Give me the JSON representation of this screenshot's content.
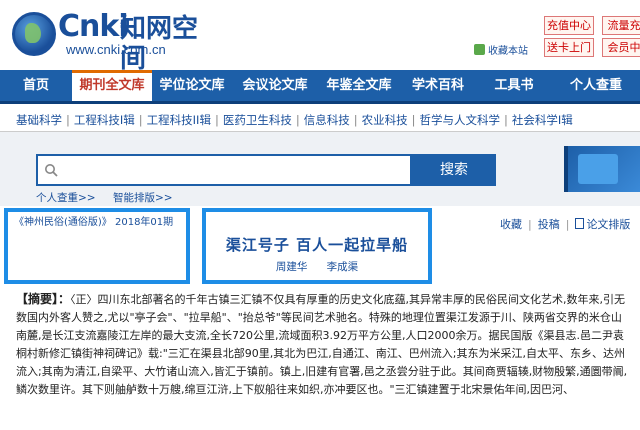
{
  "header": {
    "logo_brand": "Cnki",
    "logo_cn": "知网空间",
    "logo_url": "www.cnki.com.cn",
    "bookmark": "收藏本站",
    "buttons": [
      "充值中心",
      "流量充",
      "送卡上门",
      "会员中"
    ]
  },
  "nav": {
    "items": [
      "首页",
      "期刊全文库",
      "学位论文库",
      "会议论文库",
      "年鉴全文库",
      "学术百科",
      "工具书",
      "个人查重"
    ],
    "active_index": 1
  },
  "subnav": [
    "基础科学",
    "工程科技I辑",
    "工程科技II辑",
    "医药卫生科技",
    "信息科技",
    "农业科技",
    "哲学与人文科学",
    "社会科学I辑"
  ],
  "search": {
    "placeholder": "",
    "button": "搜索",
    "links": [
      "个人查重>>",
      "智能排版>>"
    ]
  },
  "article": {
    "source": "《神州民俗(通俗版)》 2018年01期",
    "title": "渠江号子 百人一起拉旱船",
    "authors": [
      "周建华",
      "李成渠"
    ],
    "actions": [
      "收藏",
      "投稿",
      "论文排版"
    ],
    "abstract_label": "【摘要】：",
    "abstract_text": "〈正〉四川东北部著名的千年古镇三汇镇不仅具有厚重的历史文化底蕴,其异常丰厚的民俗民间文化艺术,数年来,引无数国内外客人赞之,尤以\"亭子会\"、\"拉旱船\"、\"抬总爷\"等民间艺术驰名。特殊的地理位置渠江发源于川、陕两省交界的米仓山南麓,是长江支流嘉陵江左岸的最大支流,全长720公里,流域面积3.92万平方公里,人口2000余万。据民国版《渠县志.邑二尹袁桐村新修汇镇街神祠碑记》载:\"三汇在渠县北部90里,其北为巴江,自通江、南江、巴州流入;其东为米采江,自太平、东乡、达州流入;其南为清江,自梁平、大竹诸山流入,皆汇于镇前。镇上,旧建有官署,邑之丞尝分驻于此。其间商贾辐辏,财物殷繁,通圜带阛,鳞次数里许。其下则舳舻数十万艘,绵亘江浒,上下舣船往来如织,亦冲要区也。\"三汇镇建置于北宋景佑年间,因巴河、"
  }
}
